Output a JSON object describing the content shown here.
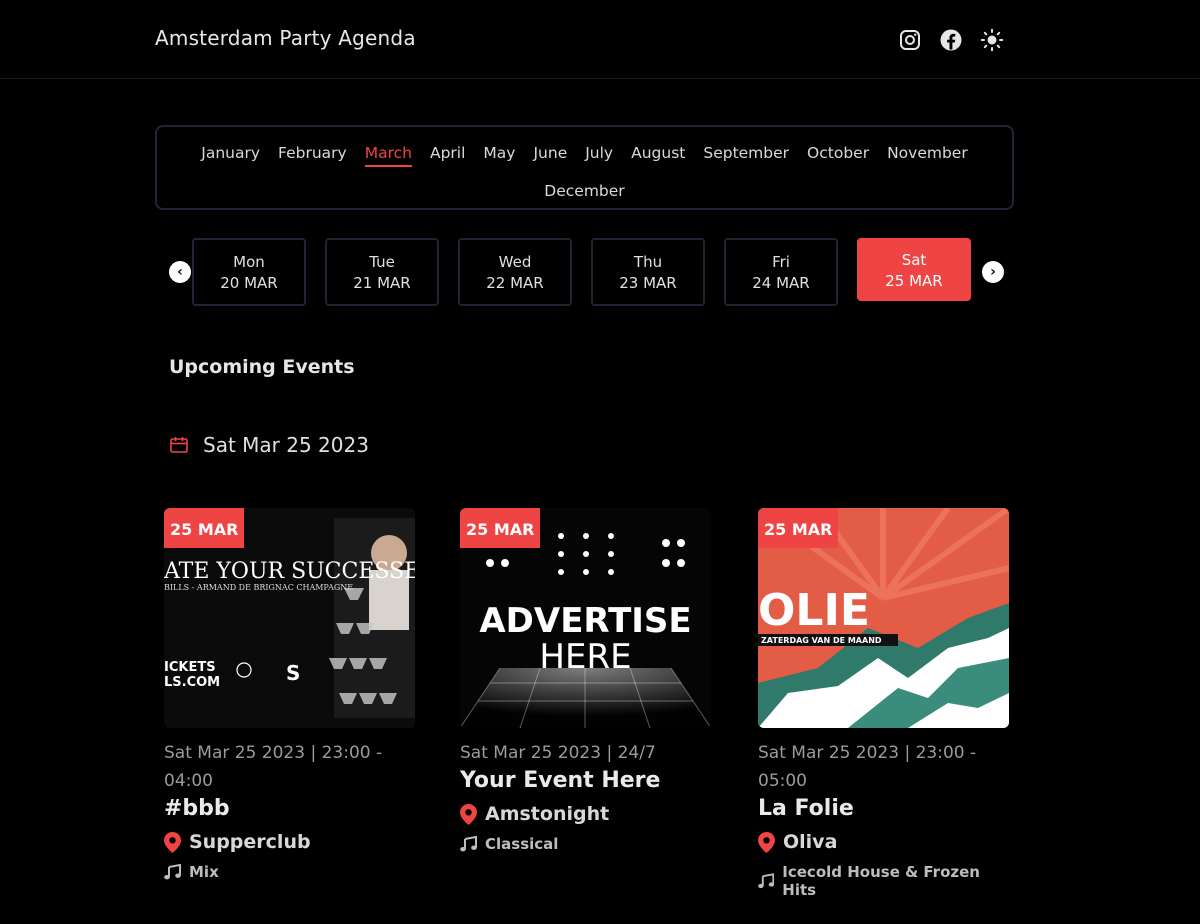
{
  "header": {
    "brand": "Amsterdam Party Agenda"
  },
  "months": [
    "January",
    "February",
    "March",
    "April",
    "May",
    "June",
    "July",
    "August",
    "September",
    "October",
    "November",
    "December"
  ],
  "active_month": "March",
  "days": [
    {
      "name": "Mon",
      "date": "20 MAR"
    },
    {
      "name": "Tue",
      "date": "21 MAR"
    },
    {
      "name": "Wed",
      "date": "22 MAR"
    },
    {
      "name": "Thu",
      "date": "23 MAR"
    },
    {
      "name": "Fri",
      "date": "24 MAR"
    },
    {
      "name": "Sat",
      "date": "25 MAR",
      "active": true
    }
  ],
  "section_title": "Upcoming Events",
  "date_heading": "Sat Mar 25 2023",
  "events": [
    {
      "badge": "25 MAR",
      "meta": "Sat Mar 25 2023 | 23:00 - 04:00",
      "title": "#bbb",
      "venue": "Supperclub",
      "genre": "Mix",
      "art": {
        "line1": "ATE YOUR SUCCESSES",
        "line2": "BILLS - ARMAND DE BRIGNAC CHAMPAGNE",
        "line3": "ICKETS",
        "line4": "LS.COM",
        "line5": "S"
      }
    },
    {
      "badge": "25 MAR",
      "meta": "Sat Mar 25 2023 | 24/7",
      "title": "Your Event Here",
      "venue": "Amstonight",
      "genre": "Classical",
      "art": {
        "line1": "ADVERTISE",
        "line2": "HERE"
      }
    },
    {
      "badge": "25 MAR",
      "meta": "Sat Mar 25 2023 | 23:00 - 05:00",
      "title": "La Folie",
      "venue": "Oliva",
      "genre": "Icecold House & Frozen Hits",
      "art": {
        "line1": "OLIE",
        "line2": "ZATERDAG VAN DE MAAND"
      }
    }
  ],
  "colors": {
    "accent": "#ef4444",
    "background": "#000000",
    "border": "#1e2533"
  }
}
